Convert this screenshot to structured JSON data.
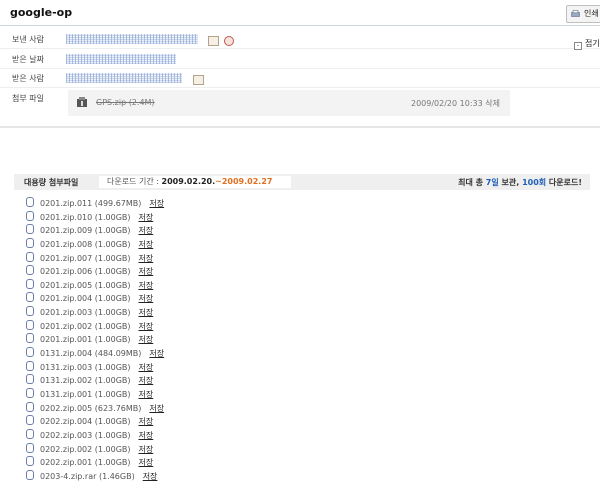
{
  "header": {
    "title": "google-op",
    "print_label": "인쇄"
  },
  "meta": {
    "sender_label": "보낸 사람",
    "date_label": "받은 날짜",
    "recipient_label": "받은 사람",
    "attachment_label": "첨부 파일",
    "collapse_label": "접기"
  },
  "attachment": {
    "file": "GPS.zip (2.4M)",
    "date": "2009/02/20 10:33",
    "delete": "삭제"
  },
  "bulk": {
    "title": "대용량 첨부파일",
    "period_label": "다운로드 기간 :",
    "period_start": "2009.02.20.",
    "period_end": "~2009.02.27",
    "info_prefix": "최대 총 ",
    "days": "7일",
    "info_mid": " 보관, ",
    "count": "100회",
    "info_suffix": " 다운로드!",
    "save_label": "저장",
    "files": [
      "0201.zip.011 (499.67MB)",
      "0201.zip.010 (1.00GB)",
      "0201.zip.009 (1.00GB)",
      "0201.zip.008 (1.00GB)",
      "0201.zip.007 (1.00GB)",
      "0201.zip.006 (1.00GB)",
      "0201.zip.005 (1.00GB)",
      "0201.zip.004 (1.00GB)",
      "0201.zip.003 (1.00GB)",
      "0201.zip.002 (1.00GB)",
      "0201.zip.001 (1.00GB)",
      "0131.zip.004 (484.09MB)",
      "0131.zip.003 (1.00GB)",
      "0131.zip.002 (1.00GB)",
      "0131.zip.001 (1.00GB)",
      "0202.zip.005 (623.76MB)",
      "0202.zip.004 (1.00GB)",
      "0202.zip.003 (1.00GB)",
      "0202.zip.002 (1.00GB)",
      "0202.zip.001 (1.00GB)",
      "0203-4.zip.rar (1.46GB)"
    ]
  }
}
